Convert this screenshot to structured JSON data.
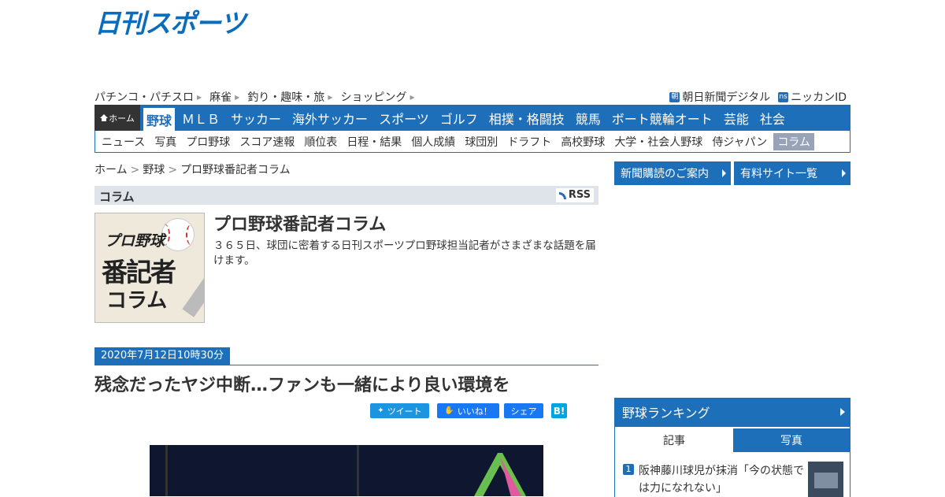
{
  "logo": "日刊スポーツ",
  "util_links": [
    "パチンコ・パチスロ",
    "麻雀",
    "釣り・趣味・旅",
    "ショッピング"
  ],
  "util_right": [
    {
      "badge": "朝",
      "label": "朝日新聞デジタル"
    },
    {
      "badge": "ns",
      "label": "ニッカンID"
    }
  ],
  "nav": {
    "home": "ホーム",
    "items": [
      "野球",
      "ＭＬＢ",
      "サッカー",
      "海外サッカー",
      "スポーツ",
      "ゴルフ",
      "相撲・格闘技",
      "競馬",
      "ボート競輪オート",
      "芸能",
      "社会"
    ],
    "sub": [
      "ニュース",
      "写真",
      "プロ野球",
      "スコア速報",
      "順位表",
      "日程・結果",
      "個人成績",
      "球団別",
      "ドラフト",
      "高校野球",
      "大学・社会人野球",
      "侍ジャパン",
      "コラム"
    ]
  },
  "breadcrumb": [
    "ホーム",
    "野球",
    "プロ野球番記者コラム"
  ],
  "column": {
    "header": "コラム",
    "rss": "RSS",
    "thumb": {
      "l1": "プロ野球",
      "l2": "番記者",
      "l3": "コラム"
    },
    "title": "プロ野球番記者コラム",
    "desc": "３６５日、球団に密着する日刊スポーツプロ野球担当記者がさまざまな話題を届けます。"
  },
  "article": {
    "date": "2020年7月12日10時30分",
    "title": "残念だったヤジ中断…ファンも一緒により良い環境を"
  },
  "share": {
    "tweet": "ツイート",
    "like": "いいね！",
    "share": "シェア",
    "hatena": "B!"
  },
  "side": {
    "btn1": "新聞購読のご案内",
    "btn2": "有料サイト一覧",
    "ranking_title": "野球ランキング",
    "tabs": [
      "記事",
      "写真"
    ],
    "rank1": {
      "num": "1",
      "text": "阪神藤川球児が抹消「今の状態では力になれない」"
    }
  },
  "colors": {
    "brand": "#1e6fb9",
    "accent": "#0a6cbc"
  }
}
